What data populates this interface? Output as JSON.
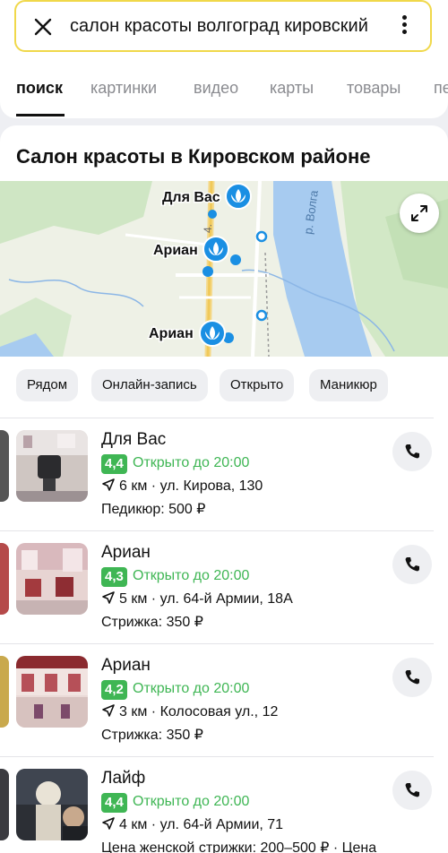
{
  "search": {
    "query": "салон красоты волгоград кировский"
  },
  "tabs": [
    {
      "label": "поиск"
    },
    {
      "label": "картинки"
    },
    {
      "label": "видео"
    },
    {
      "label": "карты"
    },
    {
      "label": "товары"
    },
    {
      "label": "пе"
    }
  ],
  "card": {
    "title": "Салон красоты в Кировском районе"
  },
  "map": {
    "labels": [
      "Для Вас",
      "Ариан",
      "Ариан"
    ],
    "river_label": "р. Волга",
    "road_label": "4."
  },
  "chips": [
    {
      "label": "Рядом"
    },
    {
      "label": "Онлайн-запись"
    },
    {
      "label": "Открыто"
    },
    {
      "label": "Маникюр"
    }
  ],
  "results": [
    {
      "name": "Для Вас",
      "rating": "4,4",
      "hours": "Открыто до 20:00",
      "distance_address": "6 км · ул. Кирова, 130",
      "price": "Педикюр: 500 ₽"
    },
    {
      "name": "Ариан",
      "rating": "4,3",
      "hours": "Открыто до 20:00",
      "distance_address": "5 км · ул. 64-й Армии, 18А",
      "price": "Стрижка: 350 ₽"
    },
    {
      "name": "Ариан",
      "rating": "4,2",
      "hours": "Открыто до 20:00",
      "distance_address": "3 км · Колосовая ул., 12",
      "price": "Стрижка: 350 ₽"
    },
    {
      "name": "Лайф",
      "rating": "4,4",
      "hours": "Открыто до 20:00",
      "distance_address": "4 км · ул. 64-й Армии, 71",
      "price": "Цена женской стрижки: 200–500 ₽ · Цена"
    }
  ],
  "colors": {
    "accent_search_border": "#f0d84a",
    "rating_green": "#3fb654",
    "map_pin_blue": "#1a8fe3",
    "river": "#a7cbf0"
  },
  "icons": [
    "close-icon",
    "more-vertical-icon",
    "expand-icon",
    "location-arrow-icon",
    "phone-icon",
    "lotus-pin-icon"
  ]
}
